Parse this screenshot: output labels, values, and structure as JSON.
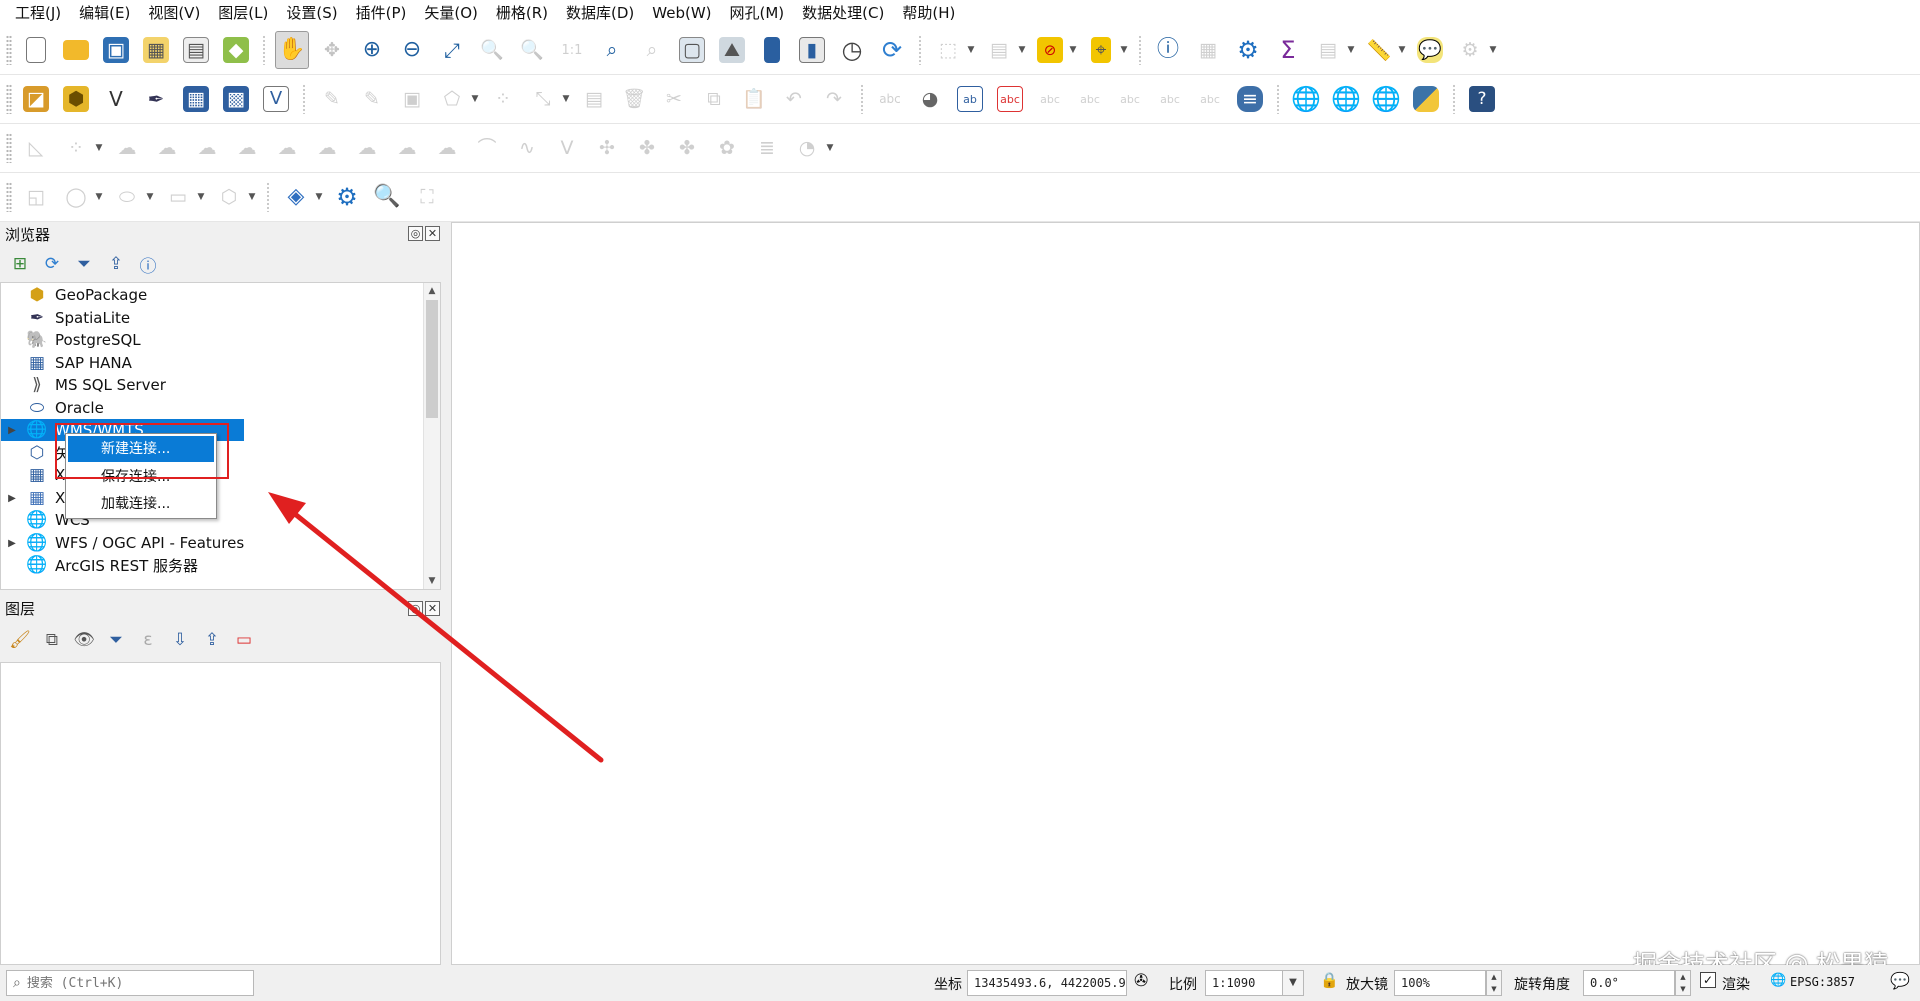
{
  "menubar": {
    "items": [
      "工程(J)",
      "编辑(E)",
      "视图(V)",
      "图层(L)",
      "设置(S)",
      "插件(P)",
      "矢量(O)",
      "栅格(R)",
      "数据库(D)",
      "Web(W)",
      "网孔(M)",
      "数据处理(C)",
      "帮助(H)"
    ]
  },
  "browser_panel": {
    "title": "浏览器",
    "items": [
      "GeoPackage",
      "SpatiaLite",
      "PostgreSQL",
      "SAP HANA",
      "MS SQL Server",
      "Oracle",
      "WMS/WMTS",
      "矢量瓦片",
      "XYZ Tiles",
      "XYZ Tiles",
      "WCS",
      "WFS / OGC API - Features",
      "ArcGIS REST 服务器"
    ],
    "visible_labels": {
      "geopackage": "GeoPackage",
      "spatialite": "SpatiaLite",
      "postgresql": "PostgreSQL",
      "saphana": "SAP HANA",
      "mssql": "MS SQL Server",
      "oracle": "Oracle",
      "wms": "WMS/WMTS",
      "vectortile": "矢",
      "xyz_a": "X",
      "xyz_b": "XY",
      "wcs": "WCS",
      "wfs": "WFS / OGC API - Features",
      "arcgis": "ArcGIS REST 服务器"
    }
  },
  "context_menu": {
    "new_connection": "新建连接...",
    "save_connections": "保存连接...",
    "load_connections": "加载连接..."
  },
  "layers_panel": {
    "title": "图层"
  },
  "statusbar": {
    "search_placeholder": "搜索 (Ctrl+K)",
    "coord_label": "坐标",
    "coord_value": "13435493.6, 4422005.9",
    "scale_label": "比例",
    "scale_value": "1:1090",
    "magnifier_label": "放大镜",
    "magnifier_value": "100%",
    "rotation_label": "旋转角度",
    "rotation_value": "0.0°",
    "render_label": "渲染",
    "crs_value": "EPSG:3857"
  },
  "watermark": "掘金技术社区 @ 松果猿",
  "colors": {
    "selection": "#0a7bd6",
    "annotation_red": "#e02020"
  }
}
